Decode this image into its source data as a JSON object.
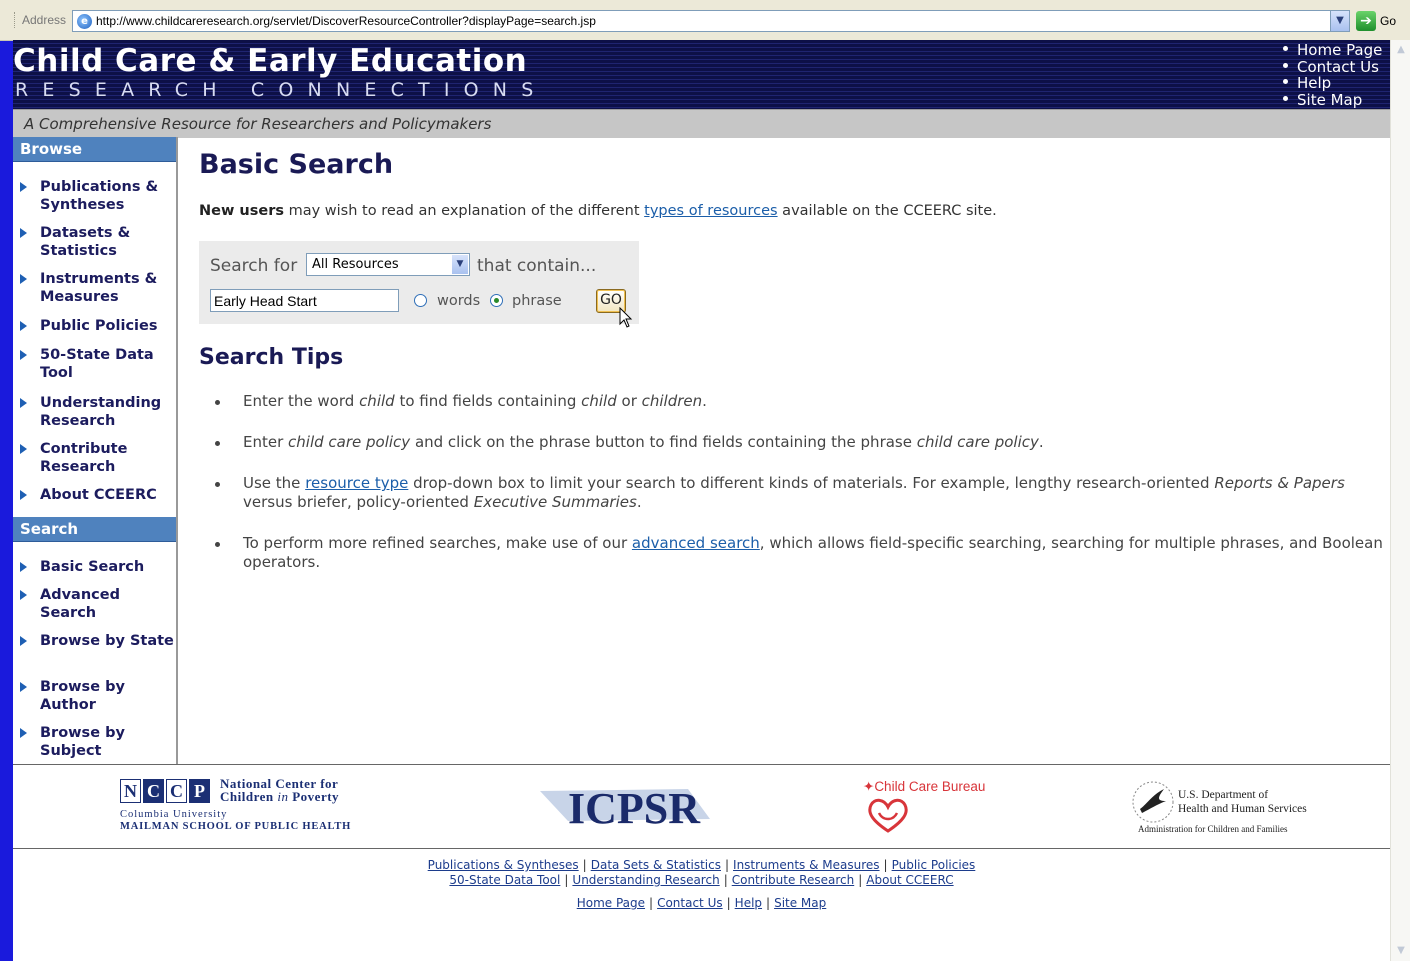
{
  "browser": {
    "address_label": "Address",
    "url": "http://www.childcareresearch.org/servlet/DiscoverResourceController?displayPage=search.jsp",
    "go_label": "Go"
  },
  "header": {
    "title": "Child Care & Early Education",
    "subtitle": "RESEARCH CONNECTIONS",
    "nav": [
      "Home Page",
      "Contact Us",
      "Help",
      "Site Map"
    ],
    "tagline": "A Comprehensive Resource for Researchers and Policymakers"
  },
  "sidebar": {
    "browse_heading": "Browse",
    "browse_items": [
      "Publications & Syntheses",
      "Datasets & Statistics",
      "Instruments & Measures",
      "Public Policies",
      "50-State Data Tool",
      "Understanding Research",
      "Contribute Research",
      "About CCEERC"
    ],
    "search_heading": "Search",
    "search_items": [
      "Basic Search",
      "Advanced Search",
      "Browse by State",
      "Browse by Author",
      "Browse by Subject"
    ]
  },
  "main": {
    "heading": "Basic Search",
    "intro_bold": "New users",
    "intro_pre": " may wish to read an explanation of the different ",
    "intro_link": "types of resources",
    "intro_post": " available on the CCEERC site.",
    "search_for_label": "Search for",
    "resource_select_value": "All Resources",
    "that_contain_label": "that contain...",
    "query_value": "Early Head Start",
    "radio_words_label": "words",
    "radio_phrase_label": "phrase",
    "selected_mode": "phrase",
    "go_button": "GO",
    "tips_heading": "Search Tips",
    "tips": {
      "t1_a": "Enter the word ",
      "t1_b": "child",
      "t1_c": " to find fields containing ",
      "t1_d": "child",
      "t1_e": " or ",
      "t1_f": "children",
      "t1_g": ".",
      "t2_a": "Enter ",
      "t2_b": "child care policy",
      "t2_c": " and click on the phrase button to find fields containing the phrase ",
      "t2_d": "child care policy",
      "t2_e": ".",
      "t3_a": "Use the ",
      "t3_link": "resource type",
      "t3_b": " drop-down box to limit your search to different kinds of materials. For example, lengthy research-oriented ",
      "t3_c": "Reports & Papers",
      "t3_d": " versus briefer, policy-oriented ",
      "t3_e": "Executive Summaries",
      "t3_f": ".",
      "t4_a": "To perform more refined searches, make use of our ",
      "t4_link": "advanced search",
      "t4_b": ", which allows field-specific searching, searching for multiple phrases, and Boolean operators."
    }
  },
  "logos": {
    "nccp_letters": [
      "N",
      "C",
      "C",
      "P"
    ],
    "nccp_name_1": "National Center for",
    "nccp_name_2a": "Children ",
    "nccp_name_2b": "in",
    "nccp_name_2c": " Poverty",
    "nccp_sub_1": "Columbia University",
    "nccp_sub_2": "MAILMAN SCHOOL OF PUBLIC HEALTH",
    "icpsr": "ICPSR",
    "ccb": "Child Care Bureau",
    "hhs_1": "U.S. Department of",
    "hhs_2": "Health and Human Services",
    "hhs_3": "Administration for Children and Families"
  },
  "footer": {
    "row1": [
      "Publications & Syntheses",
      "Data Sets & Statistics",
      "Instruments & Measures",
      "Public Policies"
    ],
    "row1b": [
      "50-State Data Tool",
      "Understanding Research",
      "Contribute Research",
      "About CCEERC"
    ],
    "row2": [
      "Home Page",
      "Contact Us",
      "Help",
      "Site Map"
    ],
    "separator": "|"
  },
  "colors": {
    "header_bg": "#0d1047",
    "sidebar_heading_bg": "#4f82be",
    "heading_text": "#1a1a55",
    "link": "#1b5ea9",
    "desktop_bg": "#1a1adc"
  }
}
